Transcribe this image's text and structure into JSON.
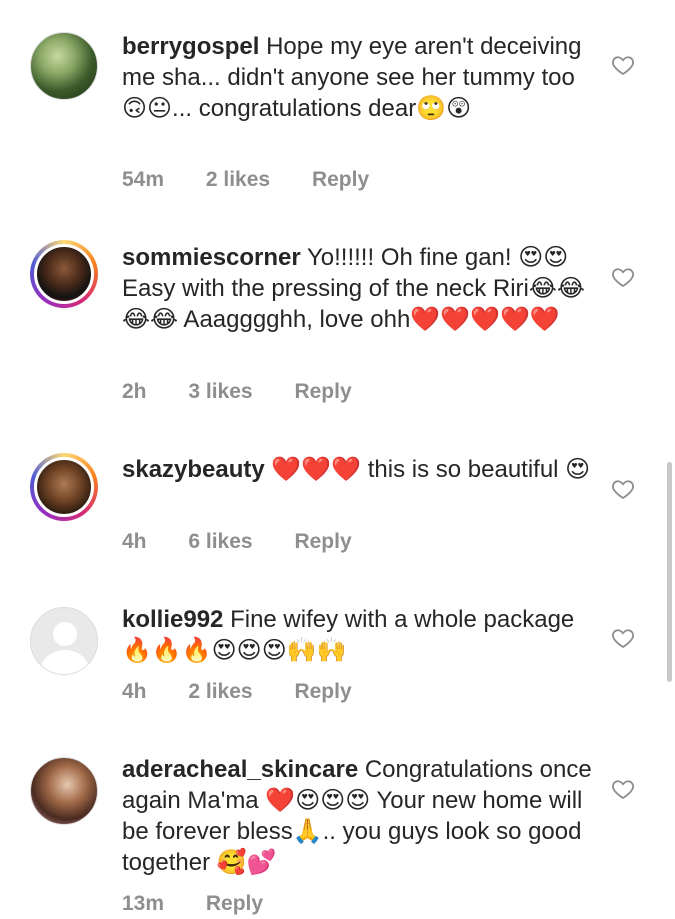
{
  "comments": [
    {
      "username": "berrygospel",
      "text": "Hope my eye aren't deceiving me sha... didn't anyone see her tummy too🙃😐... congratulations dear🙄😲",
      "time": "54m",
      "likes": "2 likes",
      "reply": "Reply",
      "avatar_icon": "user-avatar"
    },
    {
      "username": "sommiescorner",
      "text": "Yo!!!!!! Oh fine gan! 😍😍 Easy with the pressing of the neck Riri😂😂😂😂 Aaagggghh, love ohh❤️❤️❤️❤️❤️",
      "time": "2h",
      "likes": "3 likes",
      "reply": "Reply",
      "avatar_icon": "user-avatar-story-ring"
    },
    {
      "username": "skazybeauty",
      "text": "❤️❤️❤️ this is so beautiful 😍",
      "time": "4h",
      "likes": "6 likes",
      "reply": "Reply",
      "avatar_icon": "user-avatar-story-ring"
    },
    {
      "username": "kollie992",
      "text": "Fine wifey with a whole package 🔥🔥🔥😍😍😍🙌🙌",
      "time": "4h",
      "likes": "2 likes",
      "reply": "Reply",
      "avatar_icon": "default-avatar"
    },
    {
      "username": "aderacheal_skincare",
      "text": "Congratulations once again Ma'ma ❤️😍😍😍 Your new home will be forever bless🙏.. you guys look so good together 🥰💕",
      "time": "13m",
      "likes": "",
      "reply": "Reply",
      "avatar_icon": "user-avatar"
    }
  ],
  "icons": {
    "like": "heart-outline-icon"
  },
  "colors": {
    "text": "#262626",
    "meta": "#8e8e8e"
  }
}
